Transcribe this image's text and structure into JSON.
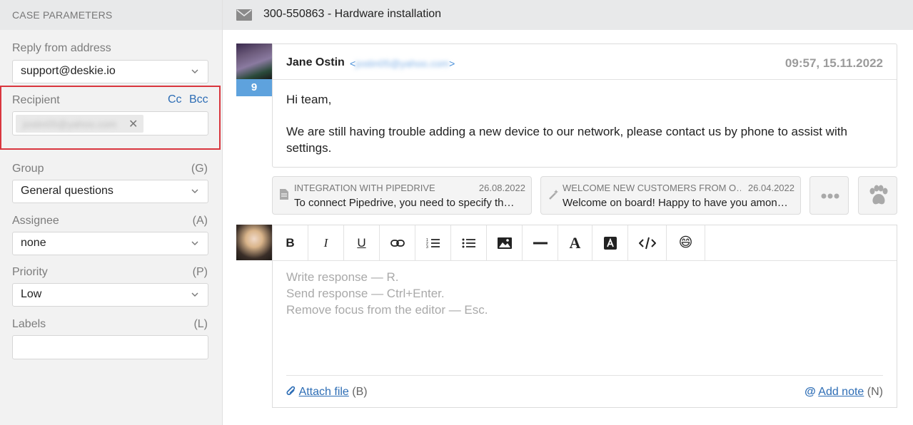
{
  "sidebar": {
    "header": "CASE PARAMETERS",
    "reply_from": {
      "label": "Reply from address",
      "value": "support@deskie.io"
    },
    "recipient": {
      "label": "Recipient",
      "cc": "Cc",
      "bcc": "Bcc",
      "chip": "jostin05@yahoo.com"
    },
    "group": {
      "label": "Group",
      "key": "(G)",
      "value": "General questions"
    },
    "assignee": {
      "label": "Assignee",
      "key": "(A)",
      "value": "none"
    },
    "priority": {
      "label": "Priority",
      "key": "(P)",
      "value": "Low"
    },
    "labels": {
      "label": "Labels",
      "key": "(L)",
      "value": ""
    }
  },
  "header": {
    "case_title": "300-550863 - Hardware installation"
  },
  "message": {
    "sender_name": "Jane Ostin",
    "sender_email": "jostin05@yahoo.com",
    "email_open": "<",
    "email_close": ">",
    "time": "09:57, 15.11.2022",
    "avatar_count": "9",
    "body": [
      "Hi team,",
      "We are still having trouble adding a new device to our network, please contact us by phone to assist with settings."
    ]
  },
  "suggestions": [
    {
      "title": "INTEGRATION WITH PIPEDRIVE",
      "date": "26.08.2022",
      "text": "To connect Pipedrive, you need to specify the …",
      "icon": "document-icon"
    },
    {
      "title": "WELCOME NEW CUSTOMERS FROM O…",
      "date": "26.04.2022",
      "text": "Welcome on board! Happy to have you amon…",
      "icon": "magic-wand-icon"
    }
  ],
  "editor": {
    "toolbar": [
      "B",
      "I",
      "U"
    ],
    "placeholder": [
      "Write response — R.",
      "Send response — Ctrl+Enter.",
      "Remove focus from the editor — Esc."
    ],
    "attach_label": "Attach file",
    "attach_key": "(B)",
    "note_label": "Add note",
    "note_key": "(N)"
  },
  "colors": {
    "accent": "#2d6db5",
    "badge": "#5ea2dd",
    "highlight_border": "#d9363e"
  }
}
